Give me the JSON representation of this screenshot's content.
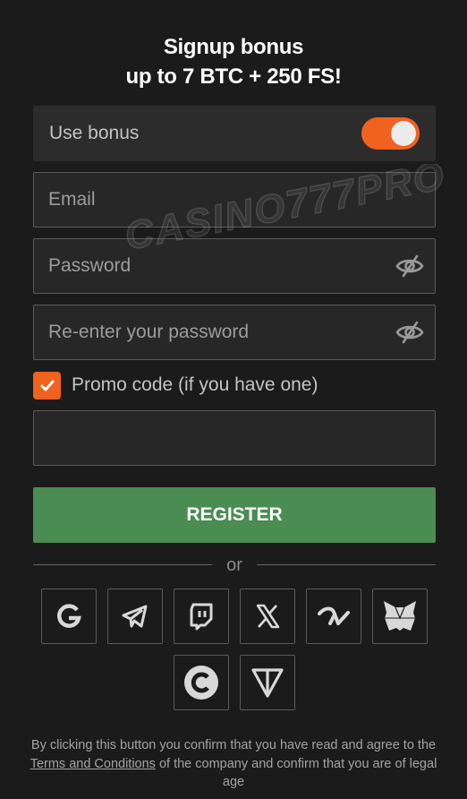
{
  "header": {
    "title_line1": "Signup bonus",
    "title_line2": "up to 7 BTC + 250 FS!"
  },
  "bonus": {
    "label": "Use bonus",
    "enabled": true
  },
  "form": {
    "email_placeholder": "Email",
    "password_placeholder": "Password",
    "repassword_placeholder": "Re-enter your password",
    "promo_label": "Promo code (if you have one)",
    "promo_checked": true,
    "promo_value": ""
  },
  "register_label": "REGISTER",
  "divider_text": "or",
  "watermark": "CASINO777PRO",
  "social_icons": [
    "google-icon",
    "telegram-icon",
    "twitch-icon",
    "x-icon",
    "walletconnect-icon",
    "metamask-icon",
    "coinbase-icon",
    "ton-icon"
  ],
  "legal": {
    "prefix": "By clicking this button you confirm that you have read and agree to the ",
    "link": "Terms and Conditions",
    "suffix": " of the company and confirm that you are of legal age"
  },
  "colors": {
    "background": "#1b1b1b",
    "accent": "#f0621e",
    "register": "#4a8c52"
  }
}
